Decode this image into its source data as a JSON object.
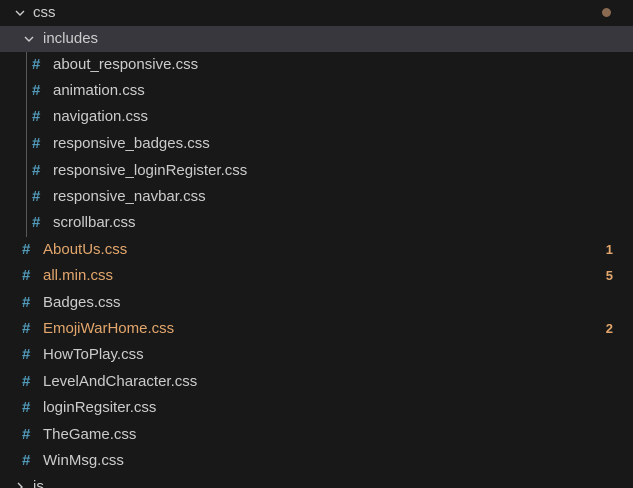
{
  "explorer": {
    "folder": {
      "name": "css",
      "subfolder": {
        "name": "includes",
        "files": [
          {
            "name": "about_responsive.css"
          },
          {
            "name": "animation.css"
          },
          {
            "name": "navigation.css"
          },
          {
            "name": "responsive_badges.css"
          },
          {
            "name": "responsive_loginRegister.css"
          },
          {
            "name": "responsive_navbar.css"
          },
          {
            "name": "scrollbar.css"
          }
        ]
      },
      "files": [
        {
          "name": "AboutUs.css",
          "badge": "1",
          "modified": true
        },
        {
          "name": "all.min.css",
          "badge": "5",
          "modified": true
        },
        {
          "name": "Badges.css",
          "modified": false
        },
        {
          "name": "EmojiWarHome.css",
          "badge": "2",
          "modified": true
        },
        {
          "name": "HowToPlay.css",
          "modified": false
        },
        {
          "name": "LevelAndCharacter.css",
          "modified": false
        },
        {
          "name": "loginRegsiter.css",
          "modified": false
        },
        {
          "name": "TheGame.css",
          "modified": false
        },
        {
          "name": "WinMsg.css",
          "modified": false
        }
      ]
    },
    "next_folder": {
      "name": "js"
    },
    "file_icon": "#",
    "colors": {
      "background": "#181818",
      "selected_row": "#37373d",
      "css_icon": "#519aba",
      "modified_text": "#e2a66c",
      "default_text": "#cccccc",
      "modified_dot": "#8b6a52"
    }
  }
}
